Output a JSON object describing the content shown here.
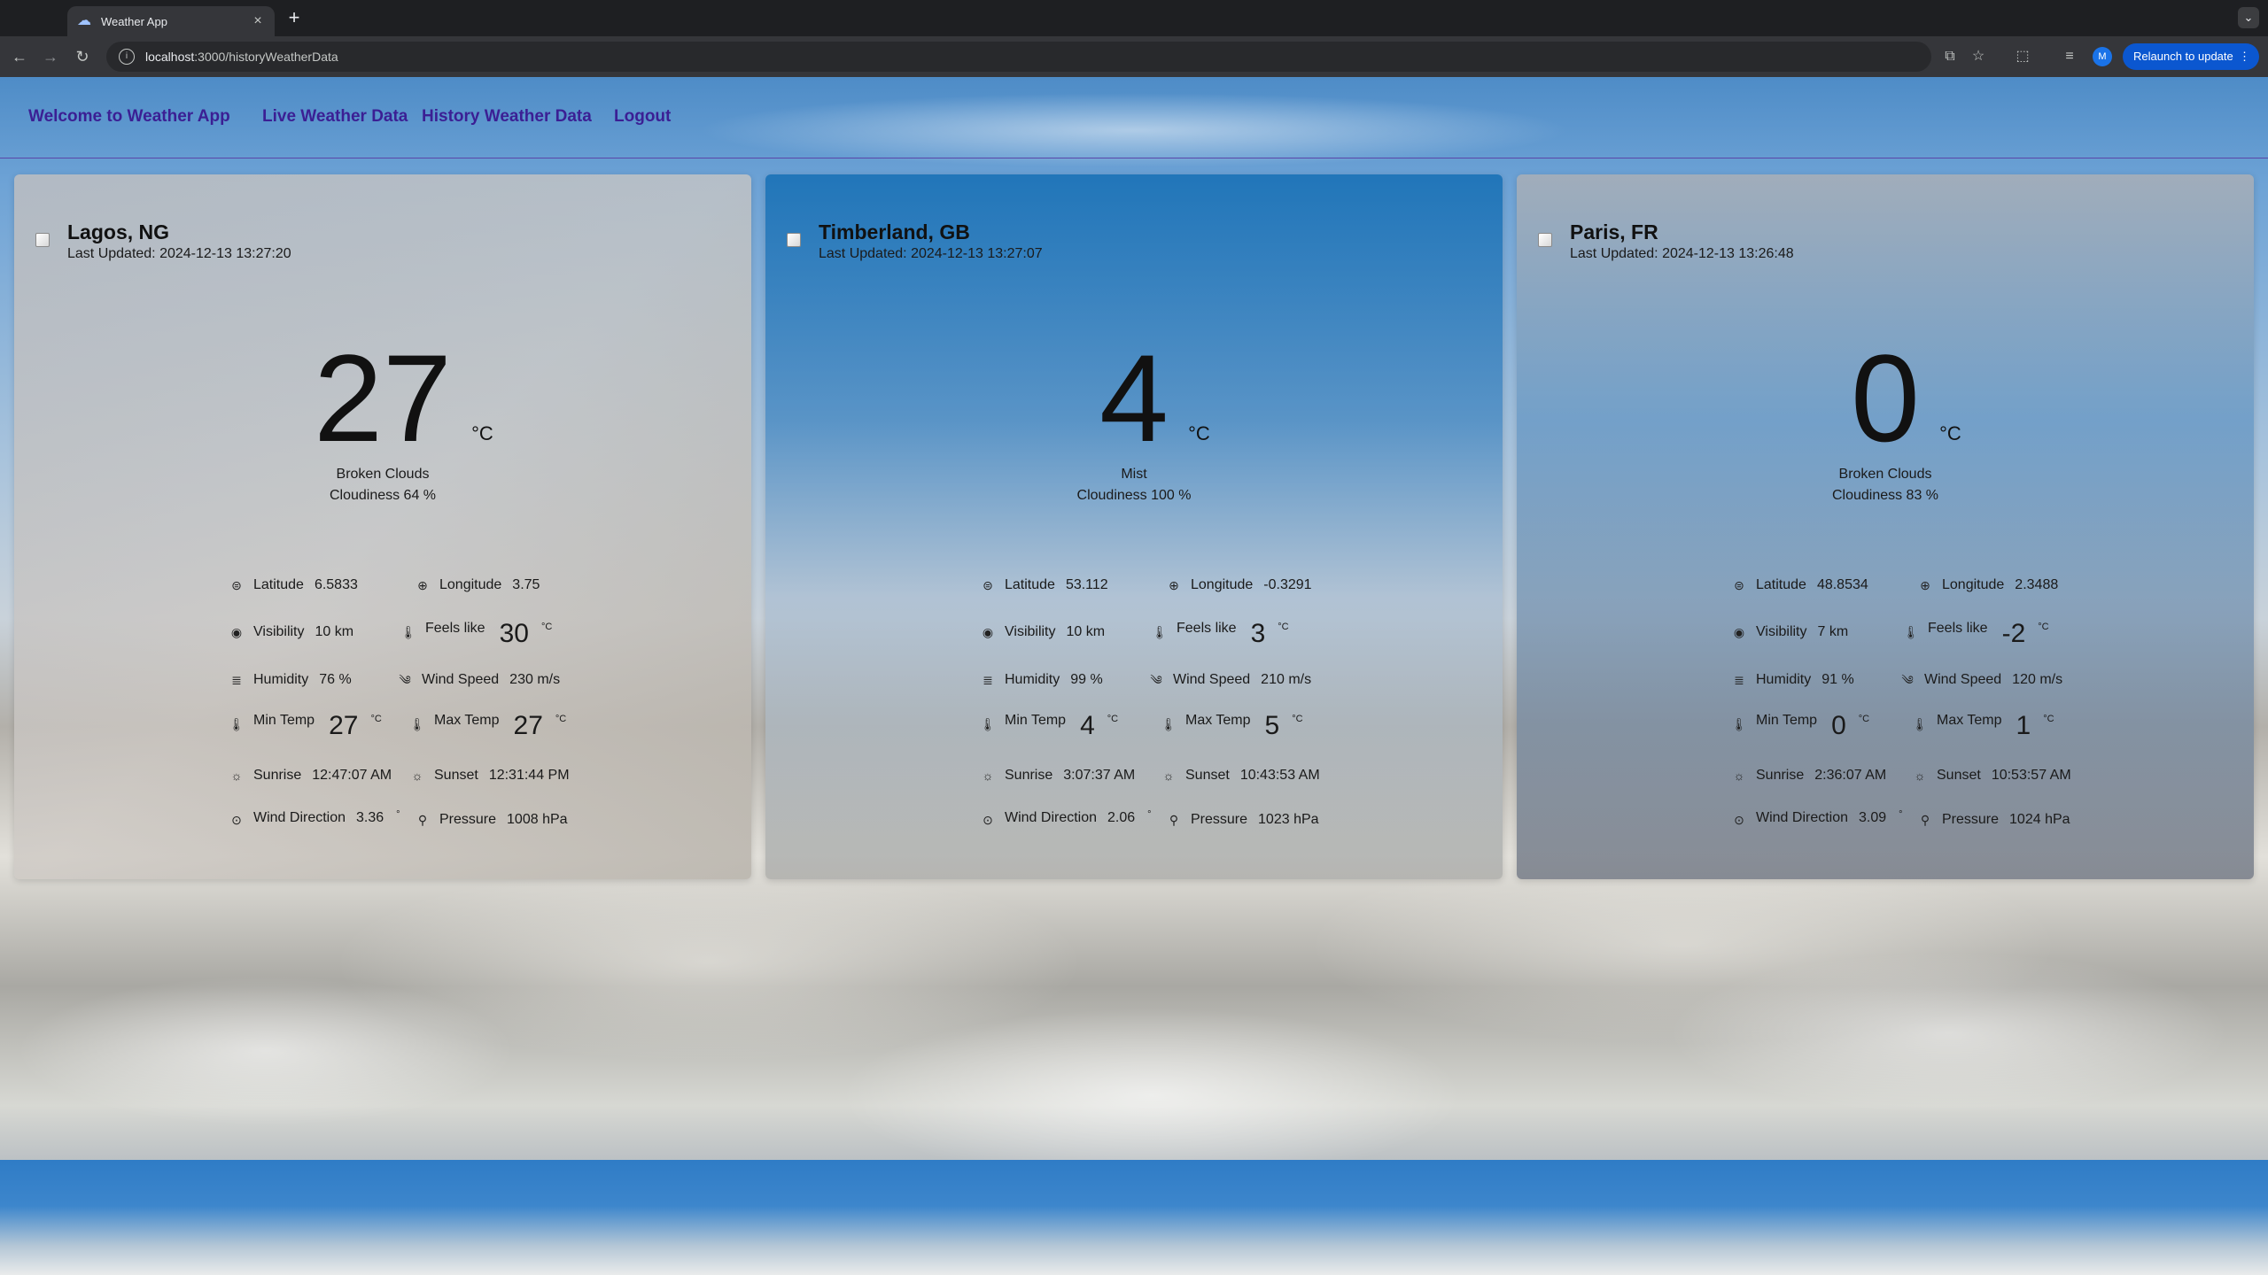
{
  "browser": {
    "tab_title": "Weather App",
    "new_tab": "+",
    "url_host": "localhost",
    "url_path": ":3000/historyWeatherData",
    "profile_initial": "M",
    "relaunch_label": "Relaunch to update",
    "relaunch_menu": "⋮"
  },
  "nav": {
    "brand": "Welcome to Weather App",
    "live": "Live Weather Data",
    "history": "History Weather Data",
    "logout": "Logout"
  },
  "labels": {
    "latitude": "Latitude",
    "longitude": "Longitude",
    "visibility": "Visibility",
    "feels_like": "Feels like",
    "humidity": "Humidity",
    "wind_speed": "Wind Speed",
    "min_temp": "Min Temp",
    "max_temp": "Max Temp",
    "sunrise": "Sunrise",
    "sunset": "Sunset",
    "wind_direction": "Wind Direction",
    "pressure": "Pressure",
    "celsius": "°C",
    "degree": "°"
  },
  "cards": [
    {
      "city": "Lagos, NG",
      "updated": "Last Updated: 2024-12-13 13:27:20",
      "temp": "27",
      "description": "Broken Clouds",
      "cloudiness": "Cloudiness 64 %",
      "latitude": "6.5833",
      "longitude": "3.75",
      "visibility": "10 km",
      "feels_like": "30",
      "humidity": "76 %",
      "wind_speed": "230 m/s",
      "min_temp": "27",
      "max_temp": "27",
      "sunrise": "12:47:07 AM",
      "sunset": "12:31:44 PM",
      "wind_direction": "3.36",
      "pressure": "1008 hPa"
    },
    {
      "city": "Timberland, GB",
      "updated": "Last Updated: 2024-12-13 13:27:07",
      "temp": "4",
      "description": "Mist",
      "cloudiness": "Cloudiness 100 %",
      "latitude": "53.112",
      "longitude": "-0.3291",
      "visibility": "10 km",
      "feels_like": "3",
      "humidity": "99 %",
      "wind_speed": "210 m/s",
      "min_temp": "4",
      "max_temp": "5",
      "sunrise": "3:07:37 AM",
      "sunset": "10:43:53 AM",
      "wind_direction": "2.06",
      "pressure": "1023 hPa"
    },
    {
      "city": "Paris, FR",
      "updated": "Last Updated: 2024-12-13 13:26:48",
      "temp": "0",
      "description": "Broken Clouds",
      "cloudiness": "Cloudiness 83 %",
      "latitude": "48.8534",
      "longitude": "2.3488",
      "visibility": "7 km",
      "feels_like": "-2",
      "humidity": "91 %",
      "wind_speed": "120 m/s",
      "min_temp": "0",
      "max_temp": "1",
      "sunrise": "2:36:07 AM",
      "sunset": "10:53:57 AM",
      "wind_direction": "3.09",
      "pressure": "1024 hPa"
    }
  ]
}
